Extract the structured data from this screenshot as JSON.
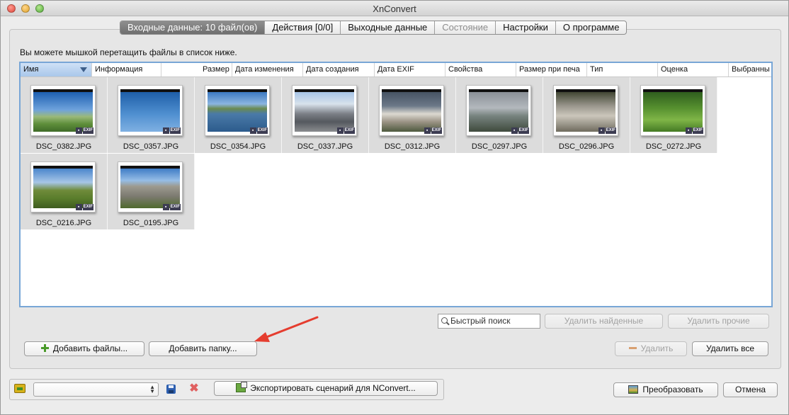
{
  "window": {
    "title": "XnConvert"
  },
  "tabs": [
    {
      "label": "Входные данные: 10 файл(ов)",
      "state": "active"
    },
    {
      "label": "Действия [0/0]",
      "state": "normal"
    },
    {
      "label": "Выходные данные",
      "state": "normal"
    },
    {
      "label": "Состояние",
      "state": "disabled"
    },
    {
      "label": "Настройки",
      "state": "normal"
    },
    {
      "label": "О программе",
      "state": "normal"
    }
  ],
  "hint": "Вы можете мышкой перетащить файлы в список ниже.",
  "columns": [
    {
      "label": "Имя",
      "sorted": true
    },
    {
      "label": "Информация"
    },
    {
      "label": "Размер"
    },
    {
      "label": "Дата изменения"
    },
    {
      "label": "Дата создания"
    },
    {
      "label": "Дата EXIF"
    },
    {
      "label": "Свойства"
    },
    {
      "label": "Размер при печа"
    },
    {
      "label": "Тип"
    },
    {
      "label": "Оценка"
    },
    {
      "label": "Выбранны"
    }
  ],
  "files": [
    {
      "name": "DSC_0382.JPG"
    },
    {
      "name": "DSC_0357.JPG"
    },
    {
      "name": "DSC_0354.JPG"
    },
    {
      "name": "DSC_0337.JPG"
    },
    {
      "name": "DSC_0312.JPG"
    },
    {
      "name": "DSC_0297.JPG"
    },
    {
      "name": "DSC_0296.JPG"
    },
    {
      "name": "DSC_0272.JPG"
    },
    {
      "name": "DSC_0216.JPG"
    },
    {
      "name": "DSC_0195.JPG"
    }
  ],
  "badges": {
    "exif": "EXIF"
  },
  "search": {
    "placeholder": "Быстрый поиск"
  },
  "buttons": {
    "delete_found": "Удалить найденные",
    "delete_others": "Удалить прочие",
    "add_files": "Добавить файлы...",
    "add_folder": "Добавить папку...",
    "delete": "Удалить",
    "delete_all": "Удалить все",
    "export_script": "Экспортировать сценарий для NConvert...",
    "convert": "Преобразовать",
    "cancel": "Отмена"
  },
  "colors": {
    "accent": "#78a6d6",
    "active_tab": "#7a7a7a",
    "arrow": "#e53d2f"
  },
  "icons": [
    "search-icon",
    "plus-icon",
    "minus-icon",
    "folder-icon",
    "save-icon",
    "delete-icon",
    "export-icon",
    "convert-icon",
    "sort-arrow-icon"
  ]
}
